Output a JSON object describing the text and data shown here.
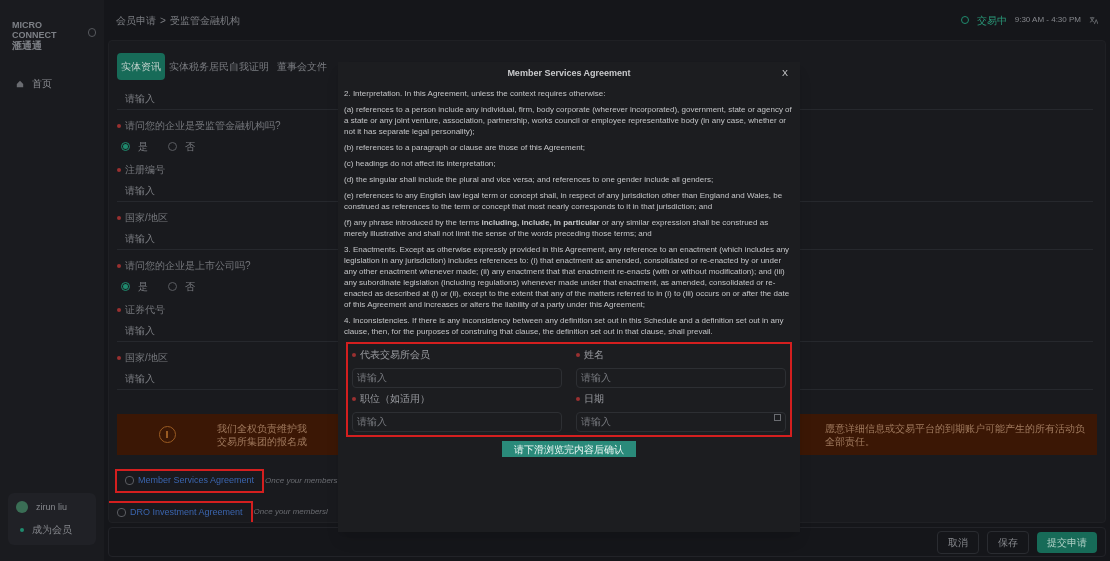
{
  "sidebar": {
    "logo": [
      "MICRO",
      "CONNECT",
      "滙通通"
    ],
    "nav": [
      {
        "label": "首页",
        "selected": true
      }
    ],
    "user": {
      "name": "zirun liu",
      "status": "成为会员"
    }
  },
  "header": {
    "breadcrumb": [
      "会员申请",
      ">",
      "受监管金融机构"
    ],
    "market": {
      "status": "交易中",
      "hours": "9:30 AM - 4:30 PM"
    }
  },
  "tabs": [
    {
      "label": "实体资讯",
      "selected": true
    },
    {
      "label": "实体税务居民自我证明",
      "selected": false
    },
    {
      "label": "董事会文件",
      "selected": false
    }
  ],
  "form": [
    {
      "kind": "input",
      "placeholder": "请输入"
    },
    {
      "kind": "radio",
      "label": "请问您的企业是受监管金融机构吗?",
      "required": true,
      "options": [
        {
          "label": "是",
          "selected": true
        },
        {
          "label": "否",
          "selected": false
        }
      ]
    },
    {
      "kind": "input",
      "label": "注册编号",
      "required": true,
      "placeholder": "请输入"
    },
    {
      "kind": "input",
      "label": "国家/地区",
      "required": true,
      "placeholder": "请输入"
    },
    {
      "kind": "radio",
      "label": "请问您的企业是上市公司吗?",
      "required": true,
      "options": [
        {
          "label": "是",
          "selected": true
        },
        {
          "label": "否",
          "selected": false
        }
      ]
    },
    {
      "kind": "input",
      "label": "证券代号",
      "required": true,
      "placeholder": "请输入"
    },
    {
      "kind": "input",
      "label": "国家/地区",
      "required": true,
      "placeholder": "请输入"
    }
  ],
  "notice": {
    "left": [
      "我们全权负责维护我",
      "交易所集团的报名成"
    ],
    "right": "愿意详细信息或交易平台的到期账户可能产生的所有活动负全部责任。"
  },
  "agreements": [
    {
      "link": "Member Services Agreement",
      "text": "Once your members",
      "checked": false,
      "highlighted": true
    },
    {
      "link": "DRO Investment Agreement",
      "text": "Once your membersl",
      "checked": false,
      "highlighted": true
    }
  ],
  "footer_buttons": [
    {
      "label": "取消",
      "kind": "secondary"
    },
    {
      "label": "保存",
      "kind": "secondary"
    },
    {
      "label": "提交申请",
      "kind": "primary"
    }
  ],
  "modal": {
    "title": "Member Services Agreement",
    "close": "X",
    "paragraphs": [
      "2. Interpretation. In this Agreement, unless the context requires otherwise:",
      "(a) references to a person include any individual, firm, body corporate (wherever incorporated), government, state or agency of a state or any joint venture, association, partnership, works council or employee representative body (in any case, whether or not it has separate legal personality);",
      "(b) references to a paragraph or clause are those of this Agreement;",
      "(c) headings do not affect its interpretation;",
      "(d) the singular shall include the plural and vice versa; and references to one gender include all genders;",
      "(e) references to any English law legal term or concept shall, in respect of any jurisdiction other than England and Wales, be construed as references to the term or concept that most nearly corresponds to it in that jurisdiction; and",
      "(f) any phrase introduced by the terms **including, include, in particular** or any similar expression shall be construed as merely illustrative and shall not limit the sense of the words preceding those terms; and",
      "3. Enactments. Except as otherwise expressly provided in this Agreement, any reference to an enactment (which includes any legislation in any jurisdiction) includes references to: (i) that enactment as amended, consolidated or re-enacted by or under any other enactment whenever made; (ii) any enactment that that enactment re-enacts (with or without modification); and (iii) any subordinate legislation (including regulations) whenever made under that enactment, as amended, consolidated or re-enacted as described at (i) or (ii), except to the extent that any of the matters referred to in (i) to (iii) occurs on or after the date of this Agreement and increases or alters the liability of a party under this Agreement;",
      "4. Inconsistencies. If there is any inconsistency between any definition set out in this Schedule and a definition set out in any clause, then, for the purposes of construing that clause, the definition set out in that clause, shall prevail."
    ],
    "fields_highlighted": true,
    "fields": [
      {
        "kind": "text",
        "label": "代表交易所会员",
        "required": true,
        "placeholder": "请输入"
      },
      {
        "kind": "text",
        "label": "姓名",
        "required": true,
        "placeholder": "请输入"
      },
      {
        "kind": "text",
        "label": "职位（如适用）",
        "required": true,
        "placeholder": "请输入"
      },
      {
        "kind": "date",
        "label": "日期",
        "required": true,
        "placeholder": "请输入"
      }
    ],
    "confirm_button": "请下滑浏览完内容后确认"
  }
}
